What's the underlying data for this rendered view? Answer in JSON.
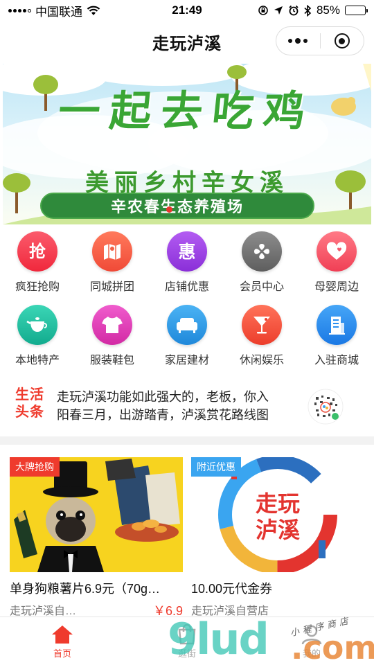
{
  "status_bar": {
    "carrier": "中国联通",
    "time": "21:49",
    "battery_percent": "85%",
    "battery_level": 0.85
  },
  "nav": {
    "title": "走玩泸溪"
  },
  "banner": {
    "headline": "一起去吃鸡",
    "subtitle": "美丽乡村辛女溪",
    "ribbon": "辛农春生态养殖场",
    "slide_count": 1,
    "active_slide": 1
  },
  "categories": [
    {
      "label": "疯狂抢购",
      "icon": "grab-icon",
      "color": "#f43b4c"
    },
    {
      "label": "同城拼团",
      "icon": "map-icon",
      "color": "#f26046"
    },
    {
      "label": "店铺优惠",
      "icon": "discount-icon",
      "color": "#9b3fe0"
    },
    {
      "label": "会员中心",
      "icon": "member-icon",
      "color": "#7a7a7a"
    },
    {
      "label": "母婴周边",
      "icon": "heart-icon",
      "color": "#f4566a"
    },
    {
      "label": "本地特产",
      "icon": "teapot-icon",
      "color": "#24c1a4"
    },
    {
      "label": "服装鞋包",
      "icon": "shirt-icon",
      "color": "#e63db8"
    },
    {
      "label": "家居建材",
      "icon": "sofa-icon",
      "color": "#2f9fe8"
    },
    {
      "label": "休闲娱乐",
      "icon": "cocktail-icon",
      "color": "#f2513b"
    },
    {
      "label": "入驻商城",
      "icon": "building-icon",
      "color": "#2b8ff0"
    }
  ],
  "news": {
    "tag_line1": "生活",
    "tag_line2": "头条",
    "items": [
      "走玩泸溪功能如此强大的，老板，你入",
      "阳春三月，出游踏青，泸溪赏花路线图"
    ]
  },
  "products": [
    {
      "badge": "大牌抢购",
      "badge_color": "#ef3b2d",
      "name": "单身狗粮薯片6.9元（70g…",
      "store": "走玩泸溪自…",
      "price": "￥6.9"
    },
    {
      "badge": "附近优惠",
      "badge_color": "#3aa5f0",
      "name": "10.00元代金券",
      "store": "走玩泸溪自营店",
      "price": "",
      "logo_text_1": "走玩",
      "logo_text_2": "泸溪"
    }
  ],
  "tabbar": [
    {
      "label": "首页",
      "icon": "home-icon",
      "active": true
    },
    {
      "label": "逛街",
      "icon": "shop-icon",
      "active": false
    },
    {
      "label": "我的",
      "icon": "user-icon",
      "active": false
    }
  ],
  "watermark": {
    "main": "9lud",
    "suffix": ".com",
    "small": "小程序商店"
  }
}
